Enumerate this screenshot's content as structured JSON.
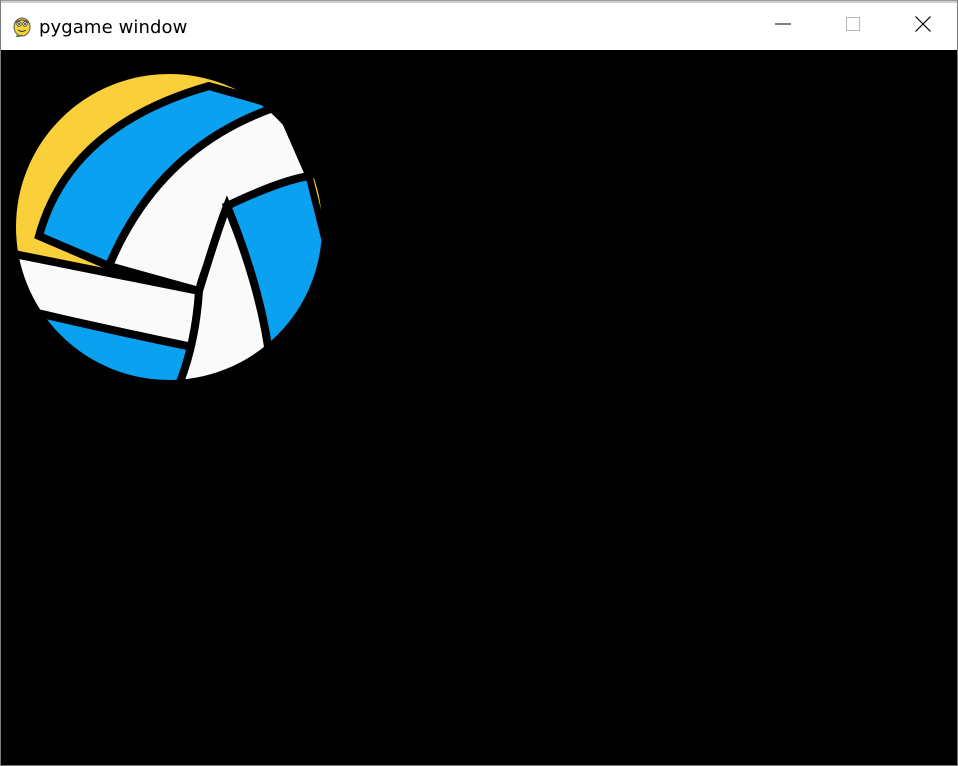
{
  "window": {
    "title": "pygame window",
    "app_icon": "pygame-snake-icon",
    "controls": {
      "minimize_icon": "minimize-icon",
      "maximize_icon": "maximize-icon",
      "close_icon": "close-icon"
    }
  },
  "canvas": {
    "background": "#000000",
    "sprite": {
      "name": "volleyball",
      "colors": {
        "yellow": "#f9cf3a",
        "blue": "#0aa1f1",
        "white": "#fafafa",
        "outline": "#000000"
      }
    }
  }
}
